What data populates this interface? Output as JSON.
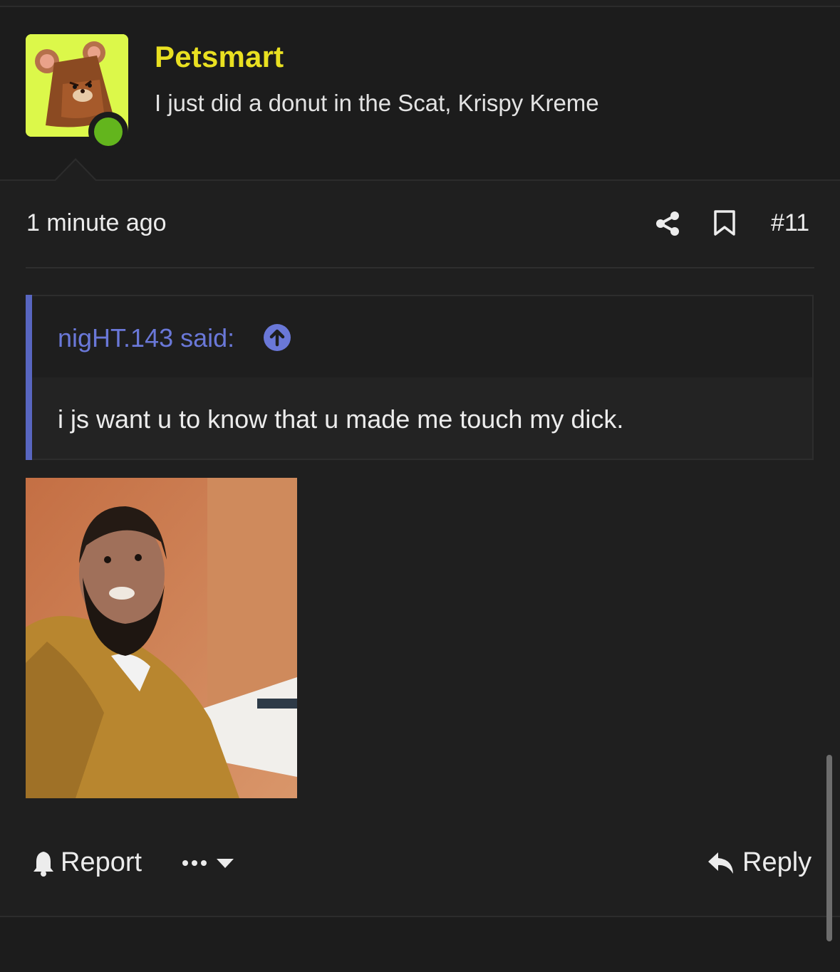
{
  "post": {
    "author": "Petsmart",
    "user_title": "I just did a donut in the Scat, Krispy Kreme",
    "time_ago": "1 minute ago",
    "post_number": "#11",
    "online": true
  },
  "quote": {
    "author_line": "nigHT.143 said:",
    "text": "i js want u to know that u made me touch my dick."
  },
  "actions": {
    "report_label": "Report",
    "reply_label": "Reply"
  },
  "icons": {
    "share": "share-icon",
    "bookmark": "bookmark-icon",
    "quote_jump": "arrow-up-circle-icon",
    "report": "bell-icon",
    "more": "ellipsis-icon",
    "dropdown": "caret-down-icon",
    "reply": "reply-arrow-icon"
  },
  "colors": {
    "background": "#1f1f1f",
    "username": "#e9e021",
    "quote_accent": "#6a78d8",
    "online": "#63b51d",
    "avatar_bg": "#dcf84a"
  }
}
